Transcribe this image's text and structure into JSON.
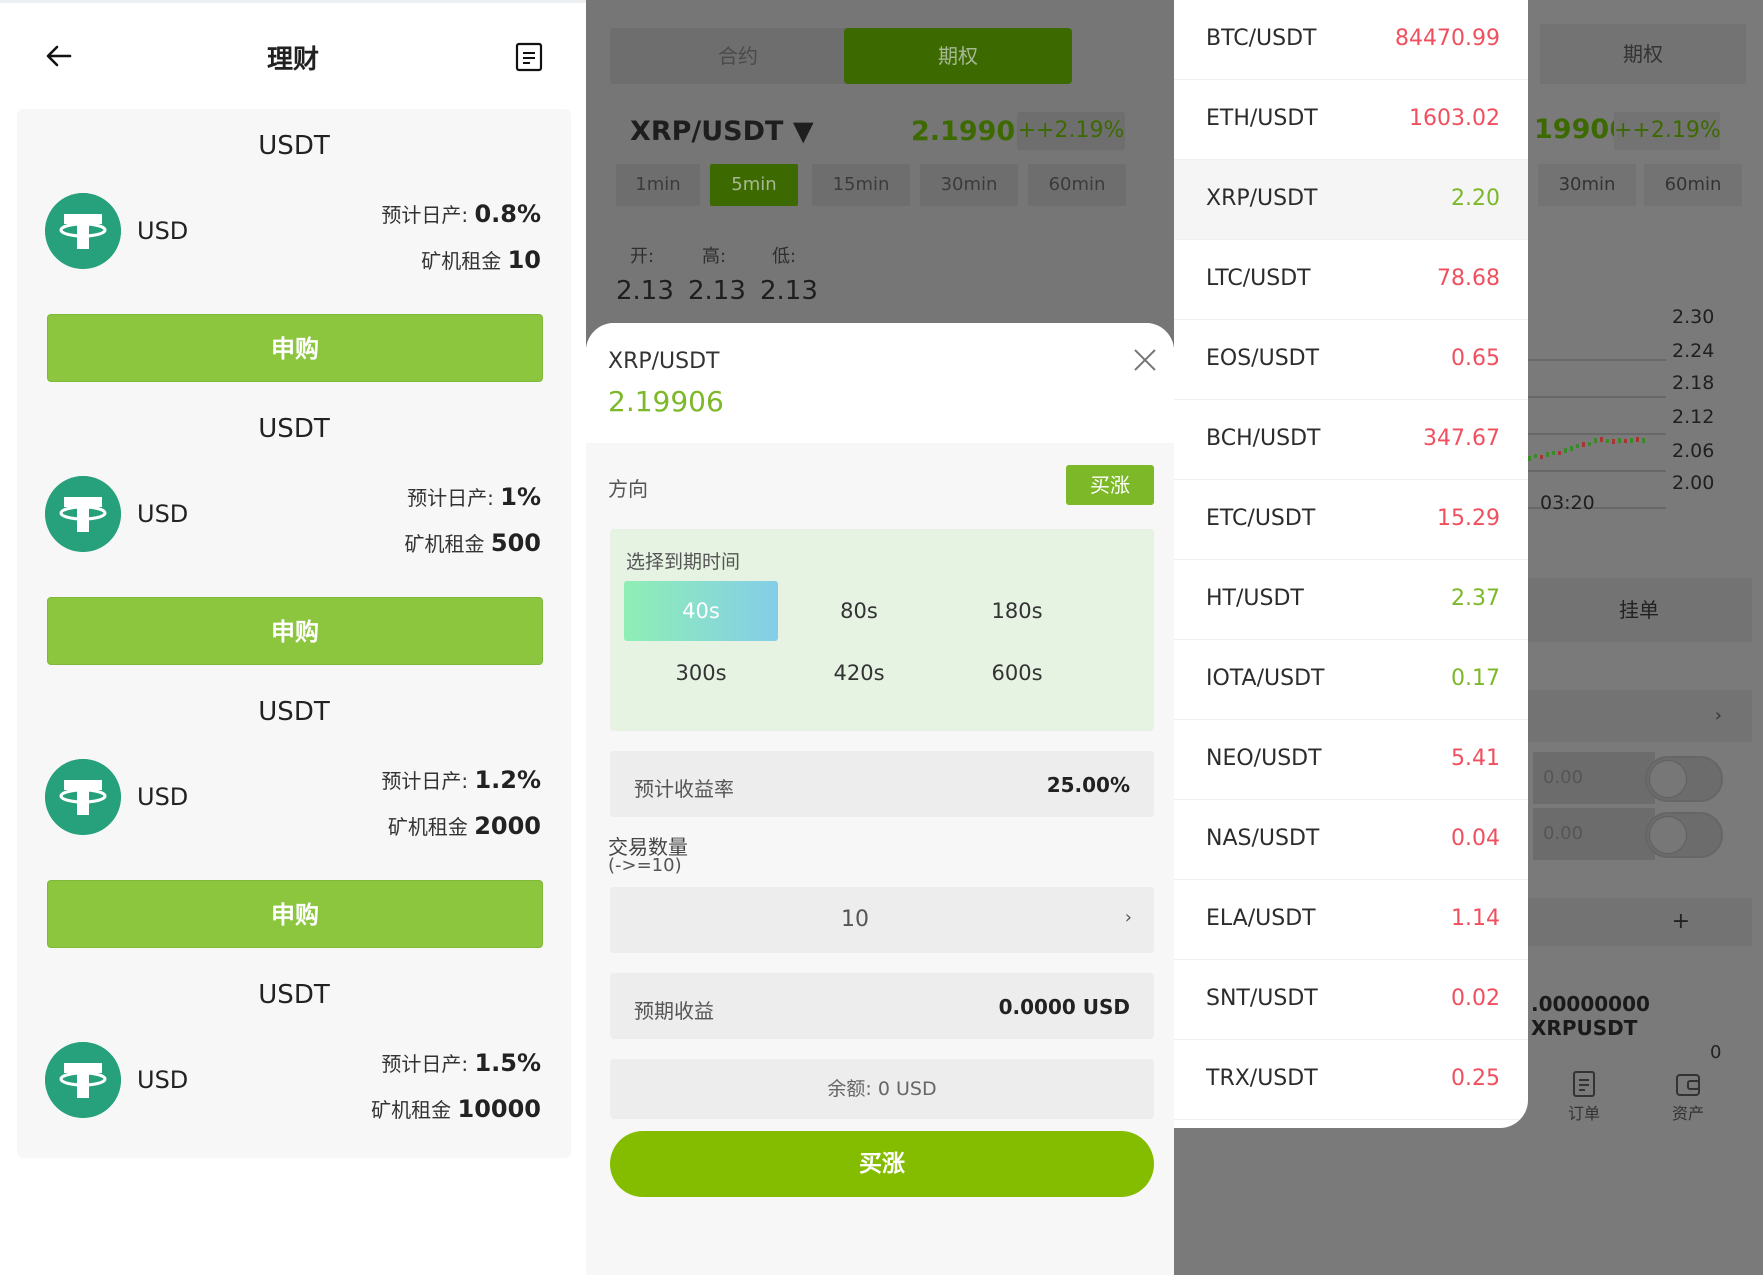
{
  "wealth": {
    "title": "理财",
    "products": [
      {
        "title": "USDT",
        "coin": "USD",
        "rate_label": "预计日产:",
        "rate": "0.8%",
        "rent_label": "矿机租金",
        "rent": "10",
        "button": "申购"
      },
      {
        "title": "USDT",
        "coin": "USD",
        "rate_label": "预计日产:",
        "rate": "1%",
        "rent_label": "矿机租金",
        "rent": "500",
        "button": "申购"
      },
      {
        "title": "USDT",
        "coin": "USD",
        "rate_label": "预计日产:",
        "rate": "1.2%",
        "rent_label": "矿机租金",
        "rent": "2000",
        "button": "申购"
      },
      {
        "title": "USDT",
        "coin": "USD",
        "rate_label": "预计日产:",
        "rate": "1.5%",
        "rent_label": "矿机租金",
        "rent": "10000",
        "button": "申购"
      }
    ]
  },
  "trade": {
    "tabs": [
      "合约",
      "期权"
    ],
    "active_tab": 1,
    "pair": "XRP/USDT ▼",
    "price": "2.19906",
    "change": "++2.19%",
    "intervals": [
      "1min",
      "5min",
      "15min",
      "30min",
      "60min"
    ],
    "active_interval": 1,
    "ohl_labels": [
      "开:",
      "高:",
      "低:"
    ],
    "ohl_values": [
      "2.13",
      "2.13",
      "2.13"
    ]
  },
  "order_sheet": {
    "pair": "XRP/USDT",
    "price": "2.19906",
    "direction_label": "方向",
    "direction_value": "买涨",
    "expiry_title": "选择到期时间",
    "expiry_options": [
      "40s",
      "80s",
      "180s",
      "300s",
      "420s",
      "600s"
    ],
    "expiry_selected": 0,
    "yield_label": "预计收益率",
    "yield_value": "25.00%",
    "quantity_label": "交易数量",
    "quantity_hint": "(->=10)",
    "quantity_value": "10",
    "profit_label": "预期收益",
    "profit_value": "0.0000 USD",
    "balance": "余额: 0 USD",
    "buy_button": "买涨"
  },
  "market_list": [
    {
      "pair": "BTC/USDT",
      "price": "84470.99",
      "trend": "down"
    },
    {
      "pair": "ETH/USDT",
      "price": "1603.02",
      "trend": "down"
    },
    {
      "pair": "XRP/USDT",
      "price": "2.20",
      "trend": "up"
    },
    {
      "pair": "LTC/USDT",
      "price": "78.68",
      "trend": "down"
    },
    {
      "pair": "EOS/USDT",
      "price": "0.65",
      "trend": "down"
    },
    {
      "pair": "BCH/USDT",
      "price": "347.67",
      "trend": "down"
    },
    {
      "pair": "ETC/USDT",
      "price": "15.29",
      "trend": "down"
    },
    {
      "pair": "HT/USDT",
      "price": "2.37",
      "trend": "up"
    },
    {
      "pair": "IOTA/USDT",
      "price": "0.17",
      "trend": "up"
    },
    {
      "pair": "NEO/USDT",
      "price": "5.41",
      "trend": "down"
    },
    {
      "pair": "NAS/USDT",
      "price": "0.04",
      "trend": "down"
    },
    {
      "pair": "ELA/USDT",
      "price": "1.14",
      "trend": "down"
    },
    {
      "pair": "SNT/USDT",
      "price": "0.02",
      "trend": "down"
    },
    {
      "pair": "TRX/USDT",
      "price": "0.25",
      "trend": "down"
    }
  ],
  "market_selected": 2,
  "background": {
    "tab": "期权",
    "price": "19906",
    "change": "++2.19%",
    "intervals": [
      "30min",
      "60min"
    ],
    "y_ticks": [
      "2.30",
      "2.24",
      "2.18",
      "2.12",
      "2.06",
      "2.00"
    ],
    "x_tick": "03:20",
    "pending_tab": "挂单",
    "input_placeholders": [
      "0.00",
      "0.00"
    ],
    "add_symbol": "+",
    "balance_text": ".00000000 XRPUSDT",
    "zero": "0",
    "nav": [
      "订单",
      "资产"
    ]
  },
  "colors": {
    "up": "#7cb828",
    "down": "#f0505e",
    "accent": "#8cc63f",
    "tether": "#26a17b"
  }
}
